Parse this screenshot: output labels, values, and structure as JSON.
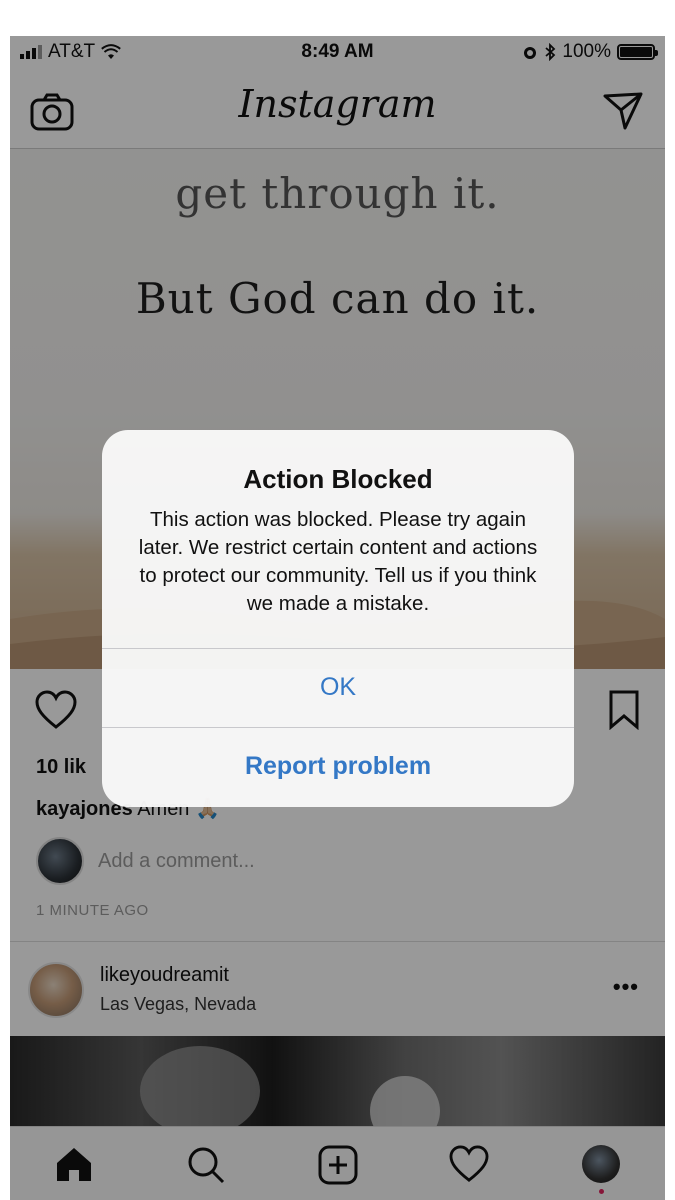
{
  "status_bar": {
    "carrier": "AT&T",
    "time": "8:49 AM",
    "battery": "100%",
    "battery_level": 1.0
  },
  "nav": {
    "logo": "Instagram",
    "camera_icon": "camera-icon",
    "direct_icon": "paper-plane-icon"
  },
  "post": {
    "quote_line1": "get through it.",
    "quote_line2": "But God can do it.",
    "likes": "10 lik",
    "caption_user": "kayajones",
    "caption_text": "Amen",
    "caption_emoji": "🙏🏼",
    "add_comment_placeholder": "Add a comment...",
    "time_ago": "1 MINUTE AGO"
  },
  "next_post": {
    "username": "likeyoudreamit",
    "location": "Las Vegas, Nevada",
    "more": "•••"
  },
  "modal": {
    "title": "Action Blocked",
    "body": "This action was blocked. Please try again later. We restrict certain content and actions to protect our community. Tell us if you think we made a mistake.",
    "ok_label": "OK",
    "report_label": "Report problem"
  },
  "tab_bar": {
    "items": [
      "home-icon",
      "search-icon",
      "new-post-icon",
      "activity-heart-icon",
      "profile-avatar"
    ]
  },
  "colors": {
    "button_blue": "#3478c6",
    "notification_dot": "#e0245e"
  }
}
